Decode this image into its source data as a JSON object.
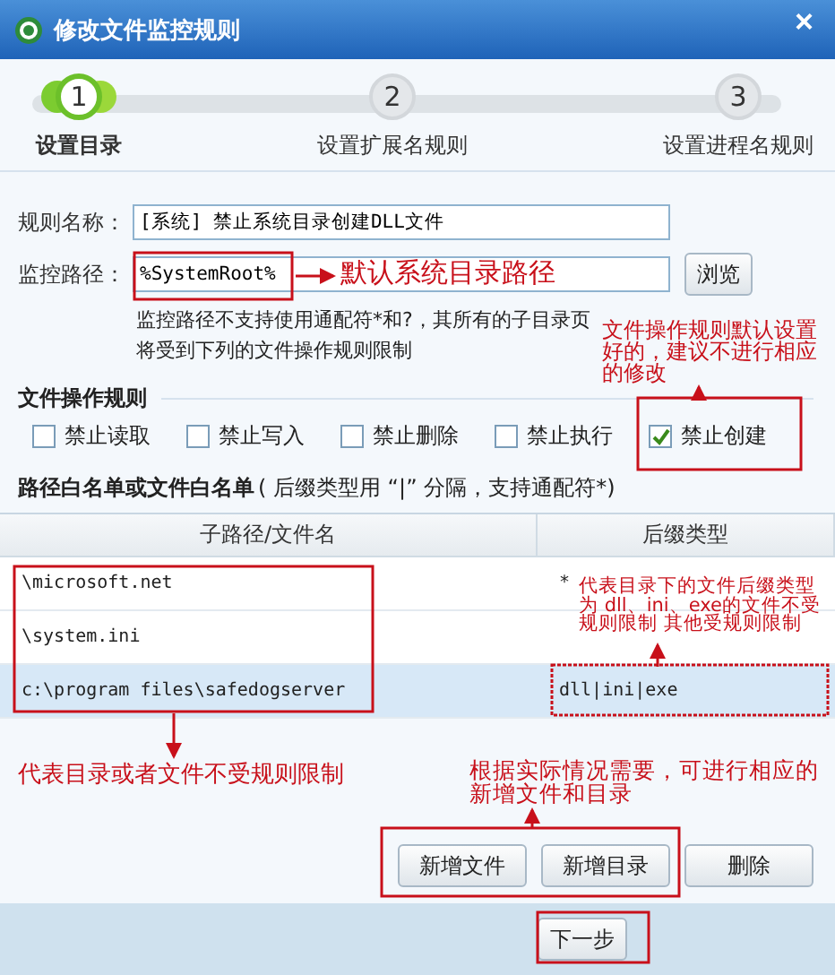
{
  "window": {
    "title": "修改文件监控规则",
    "close": "×"
  },
  "steps": [
    {
      "number": "1",
      "label": "设置目录",
      "selected": true
    },
    {
      "number": "2",
      "label": "设置扩展名规则",
      "selected": false
    },
    {
      "number": "3",
      "label": "设置进程名规则",
      "selected": false
    }
  ],
  "rule_name": {
    "label": "规则名称：",
    "value": "[系统] 禁止系统目录创建DLL文件"
  },
  "monitor_path": {
    "label": "监控路径：",
    "value": "%SystemRoot%",
    "browse": "浏览",
    "help": "监控路径不支持使用通配符*和?，其所有的子目录页将受到下列的文件操作规则限制"
  },
  "file_rules": {
    "title": "文件操作规则",
    "options": [
      {
        "label": "禁止读取",
        "checked": false
      },
      {
        "label": "禁止写入",
        "checked": false
      },
      {
        "label": "禁止删除",
        "checked": false
      },
      {
        "label": "禁止执行",
        "checked": false
      },
      {
        "label": "禁止创建",
        "checked": true
      }
    ]
  },
  "whitelist": {
    "title": "路径白名单或文件白名单",
    "hint": "( 后缀类型用 “|” 分隔，支持通配符*)",
    "columns": [
      "子路径/文件名",
      "后缀类型"
    ],
    "rows": [
      {
        "path": "\\microsoft.net",
        "suffix": "*",
        "selected": false
      },
      {
        "path": "\\system.ini",
        "suffix": "",
        "selected": false
      },
      {
        "path": "c:\\program files\\safedogserver",
        "suffix": "dll|ini|exe",
        "selected": true
      }
    ]
  },
  "buttons": [
    "新增文件",
    "新增目录",
    "删除"
  ],
  "footer": {
    "next": "下一步"
  },
  "annotations": [
    {
      "text": "默认系统目录路径"
    },
    {
      "text": "文件操作规则默认设置好的，建议不进行相应的修改"
    },
    {
      "text": "代表目录下的文件后缀类型为 dll、ini、exe的文件不受规则限制 其他受规则限制"
    },
    {
      "text": "代表目录或者文件不受规则限制"
    },
    {
      "text": "根据实际情况需要，可进行相应的新增文件和目录"
    }
  ]
}
